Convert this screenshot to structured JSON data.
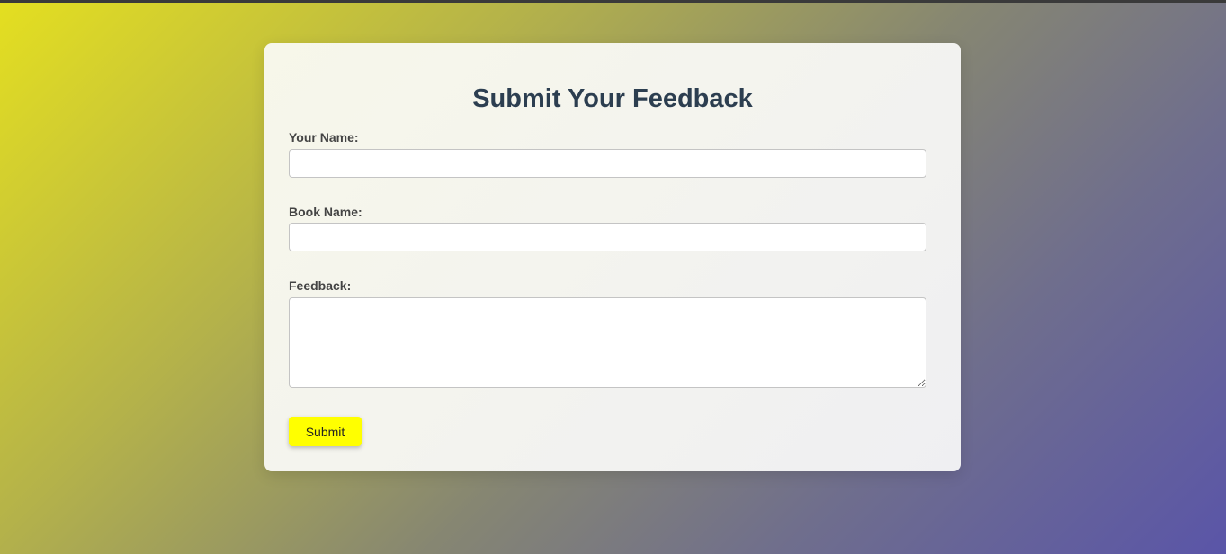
{
  "form": {
    "title": "Submit Your Feedback",
    "name_label": "Your Name:",
    "name_value": "",
    "book_label": "Book Name:",
    "book_value": "",
    "feedback_label": "Feedback:",
    "feedback_value": "",
    "submit_label": "Submit"
  },
  "colors": {
    "title": "#2c3e50",
    "submit_button": "#ffff00",
    "gradient_start": "#e4df20",
    "gradient_end": "#5a55a8"
  }
}
